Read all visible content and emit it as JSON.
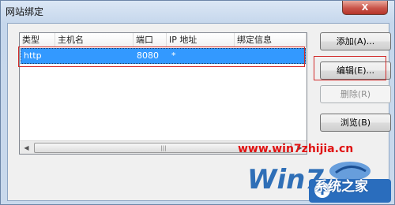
{
  "window": {
    "title": "网站绑定",
    "close_glyph": "X"
  },
  "list": {
    "columns": [
      "类型",
      "主机名",
      "端口",
      "IP 地址",
      "绑定信息"
    ],
    "rows": [
      {
        "type": "http",
        "host": "",
        "port": "8080",
        "ip": "*",
        "info": ""
      }
    ]
  },
  "buttons": {
    "add": "添加(A)...",
    "edit": "编辑(E)...",
    "remove": "删除(R)",
    "browse": "浏览(B)"
  },
  "watermark": {
    "url": "www.win7zhijia.cn",
    "logo_text": "系统之家",
    "logo_mark": "Win7"
  },
  "colors": {
    "selection": "#3399ff",
    "highlight_box": "#d22b2b",
    "watermark": "#e01212"
  }
}
